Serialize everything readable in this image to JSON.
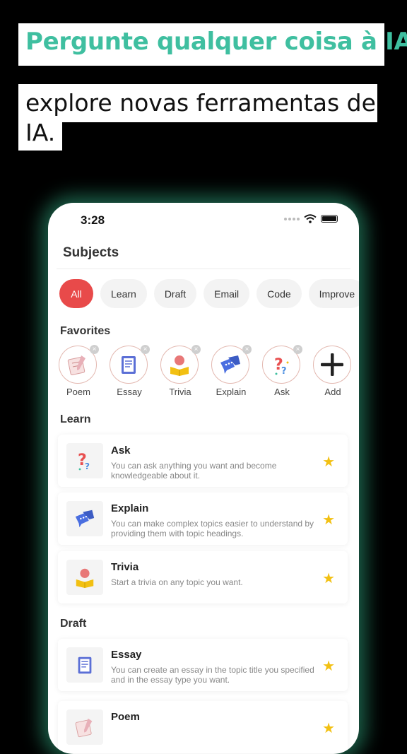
{
  "banner": {
    "headline": "Pergunte qualquer coisa à IA",
    "sub_line1": "explore novas ferramentas de",
    "sub_line2": "IA."
  },
  "status_bar": {
    "time": "3:28"
  },
  "page": {
    "title": "Subjects"
  },
  "chips": [
    "All",
    "Learn",
    "Draft",
    "Email",
    "Code",
    "Improve"
  ],
  "favorites": {
    "title": "Favorites",
    "items": [
      {
        "label": "Poem",
        "icon": "poem-icon"
      },
      {
        "label": "Essay",
        "icon": "essay-icon"
      },
      {
        "label": "Trivia",
        "icon": "trivia-icon"
      },
      {
        "label": "Explain",
        "icon": "explain-icon"
      },
      {
        "label": "Ask",
        "icon": "ask-icon"
      },
      {
        "label": "Add",
        "icon": "plus-icon"
      }
    ]
  },
  "learn": {
    "title": "Learn",
    "items": [
      {
        "title": "Ask",
        "desc": "You can ask anything you want and become knowledgeable about it."
      },
      {
        "title": "Explain",
        "desc": "You can make complex topics easier to understand by providing them with topic headings."
      },
      {
        "title": "Trivia",
        "desc": "Start a trivia on any topic you want."
      }
    ]
  },
  "draft": {
    "title": "Draft",
    "items": [
      {
        "title": "Essay",
        "desc": "You can create an essay in the topic title you specified and in the essay type you want."
      },
      {
        "title": "Poem",
        "desc": ""
      }
    ]
  },
  "colors": {
    "accent": "#3fbfa0",
    "active_chip": "#e84a4a",
    "star": "#f2c012"
  }
}
